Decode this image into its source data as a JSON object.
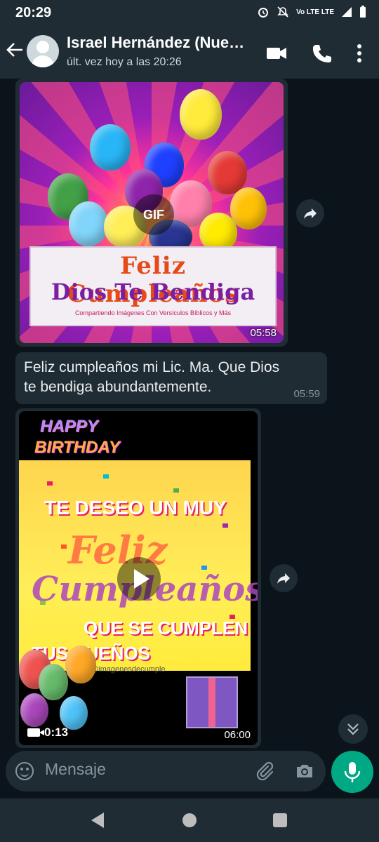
{
  "status_bar": {
    "time": "20:29",
    "network": "Vo LTE LTE"
  },
  "header": {
    "contact_name": "Israel Hernández (Nue…",
    "last_seen": "últ. vez hoy a las 20:26",
    "icons": [
      "back-arrow-icon",
      "video-call-icon",
      "phone-icon",
      "more-vertical-icon"
    ]
  },
  "messages": [
    {
      "type": "gif",
      "badge": "GIF",
      "image_text": [
        "Feliz Cumpleaños",
        "Dios Te Bendiga",
        "Compartiendo Imágenes Con Versículos Bíblicos y Más"
      ],
      "time": "05:58"
    },
    {
      "type": "text",
      "text": "Feliz cumpleaños mi Lic.  Ma. Que Dios te bendiga abundantemente.",
      "time": "05:59"
    },
    {
      "type": "video",
      "image_text": [
        "HAPPY",
        "BIRTHDAY",
        "TE DESEO UN MUY",
        "Feliz",
        "Cumpleaños",
        "QUE SE CUMPLEN",
        "TUS SUEÑOS",
        "@imagenesdecumple"
      ],
      "duration": "0:13",
      "time": "06:00"
    }
  ],
  "composer": {
    "placeholder": "Mensaje"
  },
  "colors": {
    "background": "#0b141a",
    "bubble": "#202c33",
    "bar": "#1f2c34",
    "accent": "#00a884"
  }
}
